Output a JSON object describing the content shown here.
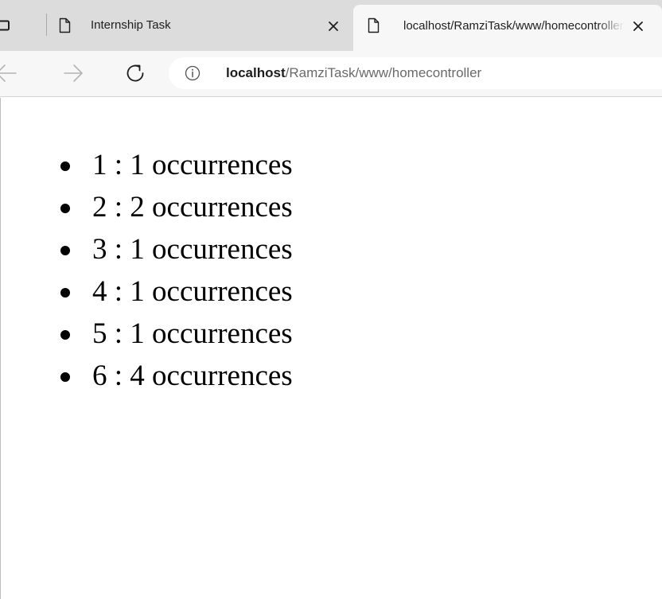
{
  "browser": {
    "tabs": [
      {
        "title": "Internship Task",
        "active": false
      },
      {
        "title": "localhost/RamziTask/www/homecontroller",
        "active": true
      }
    ],
    "address": {
      "host": "localhost",
      "path": "/RamziTask/www/homecontroller"
    },
    "icons": {
      "window": "window-icon",
      "page": "page-icon",
      "close": "close-icon",
      "back": "back-arrow-icon",
      "forward": "forward-arrow-icon",
      "reload": "reload-icon",
      "info": "info-icon"
    },
    "colors": {
      "tabstrip": "#dcdcdc",
      "toolbar": "#f7f7f7",
      "url_path": "#6a6a6a"
    }
  },
  "page": {
    "occurrences": [
      {
        "number": "1",
        "separator": " : ",
        "count": "1",
        "suffix": " occurrences"
      },
      {
        "number": "2",
        "separator": " : ",
        "count": "2",
        "suffix": " occurrences"
      },
      {
        "number": "3",
        "separator": " : ",
        "count": "1",
        "suffix": " occurrences"
      },
      {
        "number": "4",
        "separator": " : ",
        "count": "1",
        "suffix": " occurrences"
      },
      {
        "number": "5",
        "separator": " : ",
        "count": "1",
        "suffix": " occurrences"
      },
      {
        "number": "6",
        "separator": " : ",
        "count": "4",
        "suffix": " occurrences"
      }
    ]
  }
}
